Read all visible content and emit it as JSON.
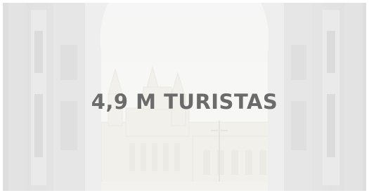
{
  "banner": {
    "headline": "4,9 M TURISTAS",
    "image_subject": "cathedral-through-open-doors",
    "text_color": "#6b6b6b",
    "overlay_color": "#ffffff"
  }
}
